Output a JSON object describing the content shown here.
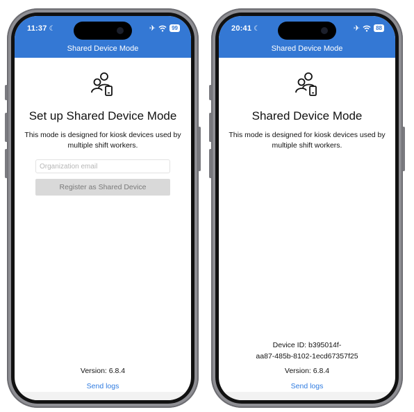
{
  "left_screen": {
    "status_time": "11:37",
    "battery": "99",
    "nav_title": "Shared Device Mode",
    "heading": "Set up Shared Device Mode",
    "description_line1": "This mode is designed for kiosk devices used by",
    "description_line2": "multiple shift workers.",
    "email_placeholder": "Organization email",
    "register_label": "Register as Shared Device",
    "version": "Version: 6.8.4",
    "send_logs": "Send logs"
  },
  "right_screen": {
    "status_time": "20:41",
    "battery": "88",
    "nav_title": "Shared Device Mode",
    "heading": "Shared Device Mode",
    "description_line1": "This mode is designed for kiosk devices used by",
    "description_line2": "multiple shift workers.",
    "device_id_line1": "Device ID: b395014f-",
    "device_id_line2": "aa87-485b-8102-1ecd67357f25",
    "version": "Version: 6.8.4",
    "send_logs": "Send logs"
  },
  "icons": {
    "moon": "moon-icon",
    "airplane": "airplane-icon",
    "wifi": "wifi-icon",
    "battery": "battery-icon",
    "app": "shared-users-device-icon"
  },
  "colors": {
    "accent": "#3478d4",
    "link": "#2f7be0",
    "button_disabled": "#d9d9d9"
  }
}
